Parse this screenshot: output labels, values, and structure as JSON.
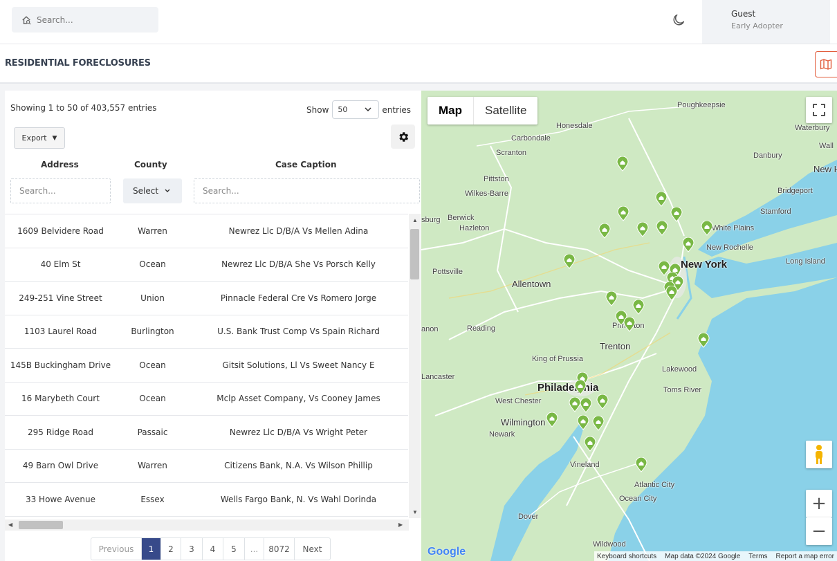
{
  "header": {
    "search_placeholder": "Search...",
    "user_name": "Guest",
    "user_role": "Early Adopter"
  },
  "page": {
    "title": "RESIDENTIAL FORECLOSURES"
  },
  "table": {
    "showing": "Showing 1 to 50 of 403,557 entries",
    "show_label": "Show",
    "page_size": "50",
    "entries_label": "entries",
    "export_label": "Export",
    "columns": [
      "Address",
      "County",
      "Case Caption"
    ],
    "filters": {
      "address_placeholder": "Search...",
      "county_select": "Select",
      "caption_placeholder": "Search..."
    },
    "rows": [
      {
        "address": "1609 Belvidere Road",
        "county": "Warren",
        "caption": "Newrez Llc D/B/A Vs Mellen Adina"
      },
      {
        "address": "40 Elm St",
        "county": "Ocean",
        "caption": "Newrez Llc D/B/A She Vs Porsch Kelly"
      },
      {
        "address": "249-251 Vine Street",
        "county": "Union",
        "caption": "Pinnacle Federal Cre Vs Romero Jorge"
      },
      {
        "address": "1103 Laurel Road",
        "county": "Burlington",
        "caption": "U.S. Bank Trust Comp Vs Spain Richard"
      },
      {
        "address": "145B Buckingham Drive",
        "county": "Ocean",
        "caption": "Gitsit Solutions, Ll Vs Sweet Nancy E"
      },
      {
        "address": "16 Marybeth Court",
        "county": "Ocean",
        "caption": "Mclp Asset Company, Vs Cooney James"
      },
      {
        "address": "295 Ridge Road",
        "county": "Passaic",
        "caption": "Newrez Llc D/B/A Vs Wright Peter"
      },
      {
        "address": "49 Barn Owl Drive",
        "county": "Warren",
        "caption": "Citizens Bank, N.A. Vs Wilson Phillip"
      },
      {
        "address": "33 Howe Avenue",
        "county": "Essex",
        "caption": "Wells Fargo Bank, N. Vs Wahl Dorinda"
      }
    ]
  },
  "pagination": {
    "previous": "Previous",
    "pages": [
      "1",
      "2",
      "3",
      "4",
      "5",
      "...",
      "8072"
    ],
    "active": "1",
    "next": "Next"
  },
  "map": {
    "type_map": "Map",
    "type_satellite": "Satellite",
    "labels": [
      "Poughkeepsie",
      "Honesdale",
      "Carbondale",
      "Scranton",
      "Waterbury",
      "Danbury",
      "New Ha",
      "Wall",
      "Pittston",
      "Wilkes-Barre",
      "Bridgeport",
      "Stamford",
      "sburg",
      "Berwick",
      "Hazleton",
      "White Plains",
      "New Rochelle",
      "New York",
      "Long Island",
      "Pottsville",
      "Allentown",
      "Reading",
      "Trenton",
      "anon",
      "King of Prussia",
      "Lancaster",
      "Philadelphia",
      "West Chester",
      "Wilmington",
      "Newark",
      "Lakewood",
      "Toms River",
      "Vineland",
      "Atlantic City",
      "Ocean City",
      "Dover",
      "Wildwood",
      "Princeton"
    ],
    "google": "Google",
    "attribution": [
      "Keyboard shortcuts",
      "Map data ©2024 Google",
      "Terms",
      "Report a map error"
    ],
    "zoom_in": "+",
    "zoom_out": "−",
    "colors": {
      "land": "#cfe9c3",
      "water": "#8ad1e8",
      "pin": "#79b845",
      "route": "#ffffff",
      "active_page": "#374a8a"
    }
  }
}
